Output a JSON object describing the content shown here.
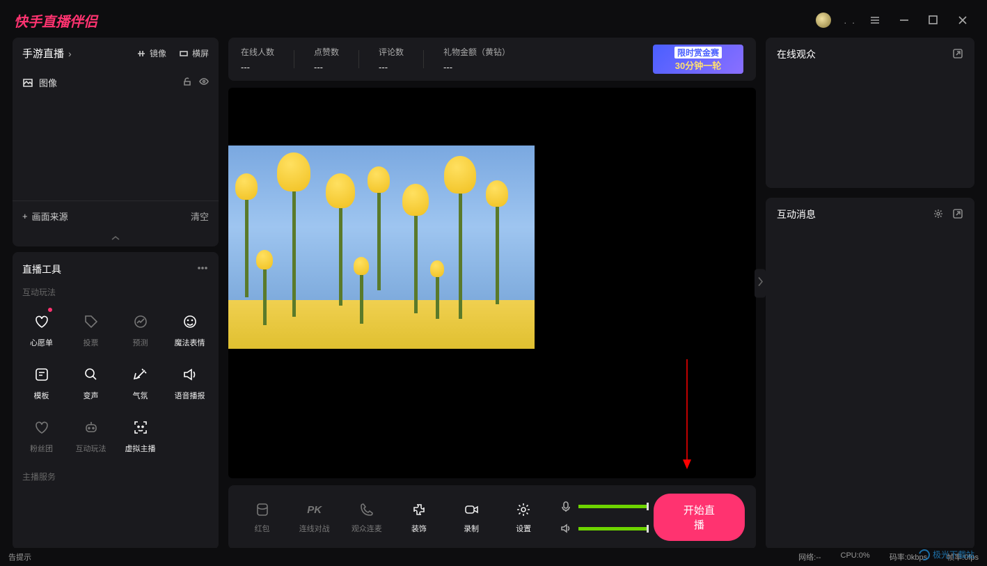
{
  "titlebar": {
    "app_title": "快手直播伴侣",
    "user_dots": ". ."
  },
  "mode_panel": {
    "title": "手游直播",
    "mirror_label": "镜像",
    "orientation_label": "横屏",
    "layer_image_label": "图像",
    "add_source_label": "画面来源",
    "clear_label": "清空"
  },
  "tools_panel": {
    "title": "直播工具",
    "groups": {
      "interactive": "互动玩法",
      "broadcast": "主播服务"
    },
    "items": {
      "wish": "心愿单",
      "vote": "投票",
      "predict": "预测",
      "magic": "魔法表情",
      "template": "模板",
      "voicefx": "变声",
      "atmosphere": "气氛",
      "tts": "语音播报",
      "fans": "粉丝团",
      "interact": "互动玩法",
      "virtual": "虚拟主播"
    }
  },
  "stats": {
    "online": {
      "label": "在线人数",
      "value": "---"
    },
    "likes": {
      "label": "点赞数",
      "value": "---"
    },
    "comments": {
      "label": "评论数",
      "value": "---"
    },
    "gifts": {
      "label": "礼物金额（黄钻）",
      "value": "---"
    },
    "promo_line1": "限时赏金赛",
    "promo_line2": "30分钟一轮"
  },
  "controls": {
    "redpacket": "红包",
    "pk": "连线对战",
    "coview": "观众连麦",
    "decor": "装饰",
    "record": "录制",
    "settings": "设置",
    "start": "开始直播"
  },
  "right": {
    "audience_title": "在线观众",
    "messages_title": "互动消息"
  },
  "statusbar": {
    "tip": "告提示",
    "net": "网络:--",
    "cpu": "CPU:0%",
    "bitrate": "码率:0kbps",
    "fps": "帧率:0fps"
  },
  "watermark": "极光下载站"
}
